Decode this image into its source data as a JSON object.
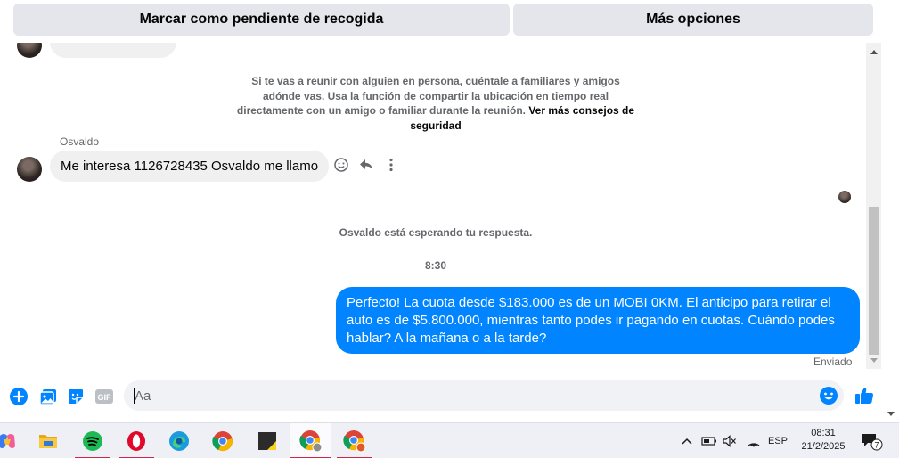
{
  "top_actions": {
    "mark_pending_label": "Marcar como pendiente de recogida",
    "more_options_label": "Más opciones"
  },
  "conversation": {
    "safety_notice": "Si te vas a reunir con alguien en persona, cuéntale a familiares y amigos adónde vas. Usa la función de compartir la ubicación en tiempo real directamente con un amigo o familiar durante la reunión.",
    "safety_link": "Ver más consejos de seguridad",
    "sender_name": "Osvaldo",
    "incoming_message": "Me interesa 1126728435 Osvaldo me llamo",
    "waiting_notice": "Osvaldo está esperando tu respuesta.",
    "timestamp": "8:30",
    "outgoing_message": "Perfecto! La cuota desde $183.000 es de un MOBI 0KM. El anticipo para retirar el auto es de $5.800.000, mientras tanto podes ir pagando en cuotas. Cuándo podes hablar? A la mañana o a la tarde?",
    "delivery_status": "Enviado"
  },
  "composer": {
    "placeholder": "Aa",
    "gif_label": "GIF"
  },
  "taskbar": {
    "apps": [
      "copilot-icon",
      "file-explorer-icon",
      "spotify-icon",
      "opera-icon",
      "edge-icon",
      "chrome-icon",
      "sticky-notes-icon",
      "chrome-profile-icon",
      "chrome-profile-2-icon"
    ],
    "language": "ESP",
    "time": "08:31",
    "date": "21/2/2025",
    "notification_count": "7"
  },
  "colors": {
    "messenger_blue": "#0084ff",
    "bubble_gray": "#f0f0f0",
    "button_gray": "#e4e6eb",
    "secondary_text": "#65676b",
    "taskbar_bg": "#eef0f5"
  }
}
